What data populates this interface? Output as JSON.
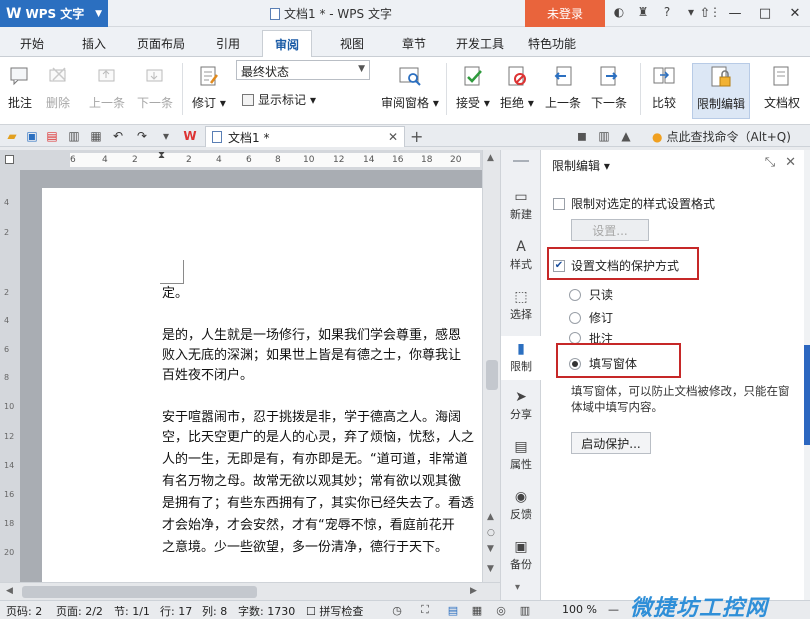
{
  "titlebar": {
    "app_name": "WPS 文字",
    "window_title": "文档1 * - WPS 文字",
    "login_label": "未登录"
  },
  "menu": {
    "tabs": [
      "开始",
      "插入",
      "页面布局",
      "引用",
      "审阅",
      "视图",
      "章节",
      "开发工具",
      "特色功能"
    ],
    "active": "审阅"
  },
  "ribbon": {
    "comment": "批注",
    "delete": "删除",
    "prev": "上一条",
    "next": "下一条",
    "revise": "修订",
    "show_markup": "显示标记",
    "final_state": "最终状态",
    "review_pane": "审阅窗格",
    "accept": "接受",
    "reject": "拒绝",
    "prev_change": "上一条",
    "next_change": "下一条",
    "compare": "比较",
    "restrict_edit": "限制编辑",
    "doc_part": "文档权"
  },
  "quickbar": {
    "doc_tab": "文档1 *",
    "find_command": "点此查找命令（Alt+Q)"
  },
  "ruler": {
    "labels": [
      "6",
      "4",
      "2",
      "2",
      "4",
      "6",
      "8",
      "10",
      "12",
      "14",
      "16",
      "18",
      "20",
      "22"
    ],
    "v_labels": [
      "4",
      "2",
      "2",
      "4",
      "6",
      "8",
      "10",
      "12",
      "14",
      "16",
      "18",
      "20",
      "22"
    ]
  },
  "document": {
    "lines": [
      "定。",
      "",
      "是的，人生就是一场修行，如果我们学会尊重，感恩",
      "败入无底的深渊；如果世上皆是有德之士，你尊我让",
      "百姓夜不闭户。",
      "",
      "安于喧嚣闹市，忍于挑拨是非，学于德高之人。海阔",
      "空，比天空更广的是人的心灵，弃了烦恼，忧愁，人之",
      "人的一生，无即是有，有亦即是无。“道可道，非常道",
      "有名万物之母。故常无欲以观其妙；常有欲以观其徼",
      "是拥有了；有些东西拥有了，其实你已经失去了。看透",
      "才会始净，才会安然，才有“宠辱不惊，看庭前花开",
      "之意境。少一些欲望，多一份清净，德行于天下。"
    ]
  },
  "sidebar": {
    "items": [
      "新建",
      "样式",
      "选择",
      "限制",
      "分享",
      "属性",
      "反馈",
      "备份"
    ]
  },
  "pane": {
    "title": "限制编辑",
    "opt_style_format": "限制对选定的样式设置格式",
    "settings_btn": "设置...",
    "opt_protect_mode": "设置文档的保护方式",
    "radio_readonly": "只读",
    "radio_revise": "修订",
    "radio_comment": "批注",
    "radio_form": "填写窗体",
    "description": "填写窗体，可以防止文档被修改，只能在窗体域中填写内容。",
    "start_btn": "启动保护..."
  },
  "statusbar": {
    "page": "页码: 2",
    "pages": "页面: 2/2",
    "section": "节: 1/1",
    "row": "行: 17",
    "col": "列: 8",
    "words": "字数: 1730",
    "spell": "拼写检查",
    "zoom": "100 %"
  },
  "watermark": "微捷坊工控网"
}
